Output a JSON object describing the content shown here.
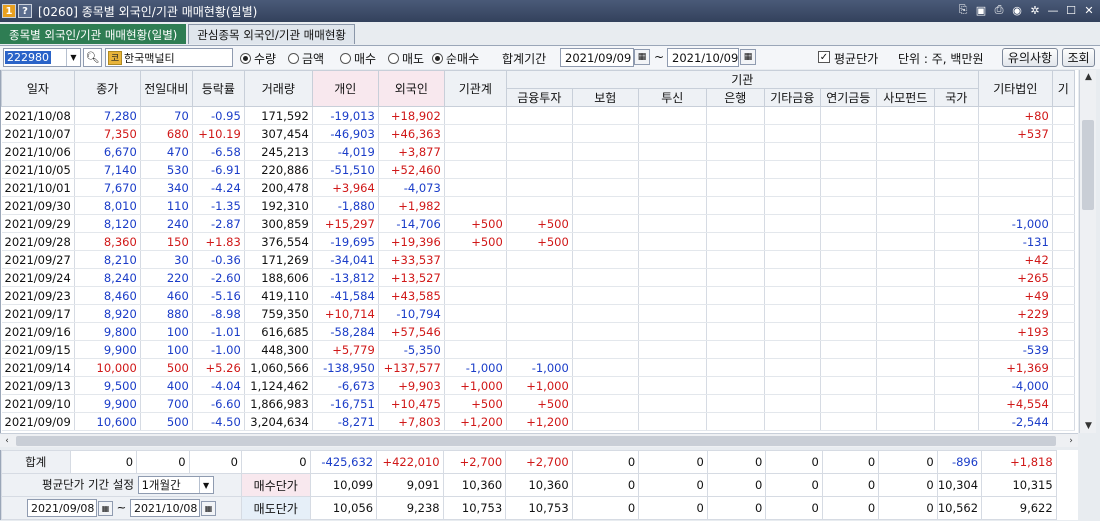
{
  "window": {
    "badge1": "1",
    "badge2": "?",
    "title": "[0260] 종목별 외국인/기관 매매현황(일별)"
  },
  "tabs": [
    "종목별 외국인/기관 매매현황(일별)",
    "관심종목 외국인/기관 매매현황"
  ],
  "toolbar": {
    "code": "222980",
    "name_badge": "코",
    "name": "한국맥널티",
    "radio1": [
      "수량",
      "금액"
    ],
    "radio2": [
      "매수",
      "매도",
      "순매수"
    ],
    "period_label": "합계기간",
    "date_from": "2021/09/09",
    "tilde": "~",
    "date_to": "2021/10/09",
    "avg_label": "평균단가",
    "unit_label": "단위 : 주, 백만원",
    "notice_btn": "유의사항",
    "query_btn": "조회"
  },
  "headers": {
    "date": "일자",
    "close": "종가",
    "change": "전일대비",
    "rate": "등락률",
    "volume": "거래량",
    "individual": "개인",
    "foreign": "외국인",
    "inst_total": "기관계",
    "inst": "기관",
    "finance": "금융투자",
    "insurance": "보험",
    "trust": "투신",
    "bank": "은행",
    "other_fin": "기타금융",
    "pension": "연기금등",
    "private": "사모펀드",
    "nation": "국가",
    "other_corp": "기타법인",
    "more": "기"
  },
  "rows": [
    {
      "date": "2021/10/08",
      "close": "7,280",
      "cc": "dn",
      "change": "70",
      "hc": "dn",
      "rate": "-0.95",
      "rc": "dn",
      "volume": "171,592",
      "ind": "-19,013",
      "ic": "dn",
      "frg": "+18,902",
      "fc": "up",
      "inst": "",
      "fin": "",
      "ocorp": "+80",
      "oc": "up"
    },
    {
      "date": "2021/10/07",
      "close": "7,350",
      "cc": "up",
      "change": "680",
      "hc": "up",
      "rate": "+10.19",
      "rc": "up",
      "volume": "307,454",
      "ind": "-46,903",
      "ic": "dn",
      "frg": "+46,363",
      "fc": "up",
      "inst": "",
      "fin": "",
      "ocorp": "+537",
      "oc": "up"
    },
    {
      "date": "2021/10/06",
      "close": "6,670",
      "cc": "dn",
      "change": "470",
      "hc": "dn",
      "rate": "-6.58",
      "rc": "dn",
      "volume": "245,213",
      "ind": "-4,019",
      "ic": "dn",
      "frg": "+3,877",
      "fc": "up",
      "inst": "",
      "fin": "",
      "ocorp": "",
      "oc": "bk"
    },
    {
      "date": "2021/10/05",
      "close": "7,140",
      "cc": "dn",
      "change": "530",
      "hc": "dn",
      "rate": "-6.91",
      "rc": "dn",
      "volume": "220,886",
      "ind": "-51,510",
      "ic": "dn",
      "frg": "+52,460",
      "fc": "up",
      "inst": "",
      "fin": "",
      "ocorp": "",
      "oc": "bk"
    },
    {
      "date": "2021/10/01",
      "close": "7,670",
      "cc": "dn",
      "change": "340",
      "hc": "dn",
      "rate": "-4.24",
      "rc": "dn",
      "volume": "200,478",
      "ind": "+3,964",
      "ic": "up",
      "frg": "-4,073",
      "fc": "dn",
      "inst": "",
      "fin": "",
      "ocorp": "",
      "oc": "bk"
    },
    {
      "date": "2021/09/30",
      "close": "8,010",
      "cc": "dn",
      "change": "110",
      "hc": "dn",
      "rate": "-1.35",
      "rc": "dn",
      "volume": "192,310",
      "ind": "-1,880",
      "ic": "dn",
      "frg": "+1,982",
      "fc": "up",
      "inst": "",
      "fin": "",
      "ocorp": "",
      "oc": "bk"
    },
    {
      "date": "2021/09/29",
      "close": "8,120",
      "cc": "dn",
      "change": "240",
      "hc": "dn",
      "rate": "-2.87",
      "rc": "dn",
      "volume": "300,859",
      "ind": "+15,297",
      "ic": "up",
      "frg": "-14,706",
      "fc": "dn",
      "inst": "+500",
      "fin": "+500",
      "ocorp": "-1,000",
      "oc": "dn"
    },
    {
      "date": "2021/09/28",
      "close": "8,360",
      "cc": "up",
      "change": "150",
      "hc": "up",
      "rate": "+1.83",
      "rc": "up",
      "volume": "376,554",
      "ind": "-19,695",
      "ic": "dn",
      "frg": "+19,396",
      "fc": "up",
      "inst": "+500",
      "fin": "+500",
      "ocorp": "-131",
      "oc": "dn"
    },
    {
      "date": "2021/09/27",
      "close": "8,210",
      "cc": "dn",
      "change": "30",
      "hc": "dn",
      "rate": "-0.36",
      "rc": "dn",
      "volume": "171,269",
      "ind": "-34,041",
      "ic": "dn",
      "frg": "+33,537",
      "fc": "up",
      "inst": "",
      "fin": "",
      "ocorp": "+42",
      "oc": "up"
    },
    {
      "date": "2021/09/24",
      "close": "8,240",
      "cc": "dn",
      "change": "220",
      "hc": "dn",
      "rate": "-2.60",
      "rc": "dn",
      "volume": "188,606",
      "ind": "-13,812",
      "ic": "dn",
      "frg": "+13,527",
      "fc": "up",
      "inst": "",
      "fin": "",
      "ocorp": "+265",
      "oc": "up"
    },
    {
      "date": "2021/09/23",
      "close": "8,460",
      "cc": "dn",
      "change": "460",
      "hc": "dn",
      "rate": "-5.16",
      "rc": "dn",
      "volume": "419,110",
      "ind": "-41,584",
      "ic": "dn",
      "frg": "+43,585",
      "fc": "up",
      "inst": "",
      "fin": "",
      "ocorp": "+49",
      "oc": "up"
    },
    {
      "date": "2021/09/17",
      "close": "8,920",
      "cc": "dn",
      "change": "880",
      "hc": "dn",
      "rate": "-8.98",
      "rc": "dn",
      "volume": "759,350",
      "ind": "+10,714",
      "ic": "up",
      "frg": "-10,794",
      "fc": "dn",
      "inst": "",
      "fin": "",
      "ocorp": "+229",
      "oc": "up"
    },
    {
      "date": "2021/09/16",
      "close": "9,800",
      "cc": "dn",
      "change": "100",
      "hc": "dn",
      "rate": "-1.01",
      "rc": "dn",
      "volume": "616,685",
      "ind": "-58,284",
      "ic": "dn",
      "frg": "+57,546",
      "fc": "up",
      "inst": "",
      "fin": "",
      "ocorp": "+193",
      "oc": "up"
    },
    {
      "date": "2021/09/15",
      "close": "9,900",
      "cc": "dn",
      "change": "100",
      "hc": "dn",
      "rate": "-1.00",
      "rc": "dn",
      "volume": "448,300",
      "ind": "+5,779",
      "ic": "up",
      "frg": "-5,350",
      "fc": "dn",
      "inst": "",
      "fin": "",
      "ocorp": "-539",
      "oc": "dn"
    },
    {
      "date": "2021/09/14",
      "close": "10,000",
      "cc": "up",
      "change": "500",
      "hc": "up",
      "rate": "+5.26",
      "rc": "up",
      "volume": "1,060,566",
      "ind": "-138,950",
      "ic": "dn",
      "frg": "+137,577",
      "fc": "up",
      "inst": "-1,000",
      "fin": "-1,000",
      "ocorp": "+1,369",
      "oc": "up"
    },
    {
      "date": "2021/09/13",
      "close": "9,500",
      "cc": "dn",
      "change": "400",
      "hc": "dn",
      "rate": "-4.04",
      "rc": "dn",
      "volume": "1,124,462",
      "ind": "-6,673",
      "ic": "dn",
      "frg": "+9,903",
      "fc": "up",
      "inst": "+1,000",
      "fin": "+1,000",
      "ocorp": "-4,000",
      "oc": "dn"
    },
    {
      "date": "2021/09/10",
      "close": "9,900",
      "cc": "dn",
      "change": "700",
      "hc": "dn",
      "rate": "-6.60",
      "rc": "dn",
      "volume": "1,866,983",
      "ind": "-16,751",
      "ic": "dn",
      "frg": "+10,475",
      "fc": "up",
      "inst": "+500",
      "fin": "+500",
      "ocorp": "+4,554",
      "oc": "up"
    },
    {
      "date": "2021/09/09",
      "close": "10,600",
      "cc": "dn",
      "change": "500",
      "hc": "dn",
      "rate": "-4.50",
      "rc": "dn",
      "volume": "3,204,634",
      "ind": "-8,271",
      "ic": "dn",
      "frg": "+7,803",
      "fc": "up",
      "inst": "+1,200",
      "fin": "+1,200",
      "ocorp": "-2,544",
      "oc": "dn"
    }
  ],
  "summary": {
    "label": "합계",
    "cells": [
      "0",
      "0",
      "0",
      "0",
      "-425,632",
      "+422,010",
      "+2,700",
      "+2,700",
      "0",
      "0",
      "0",
      "0",
      "0",
      "0",
      "-896",
      "+1,818"
    ],
    "avg_period_label": "평균단가 기간 설정",
    "avg_period_value": "1개월간",
    "buy_label": "매수단가",
    "buy": [
      "10,099",
      "9,091",
      "10,360",
      "10,360",
      "0",
      "0",
      "0",
      "0",
      "0",
      "0",
      "10,304",
      "10,315"
    ],
    "sell_label": "매도단가",
    "sell": [
      "10,056",
      "9,238",
      "10,753",
      "10,753",
      "0",
      "0",
      "0",
      "0",
      "0",
      "0",
      "10,562",
      "9,622"
    ],
    "from": "2021/09/08",
    "tilde": "~",
    "to": "2021/10/08"
  },
  "colors": {
    "up": "#d01818",
    "down": "#1a3cc8",
    "accent_tab": "#2e7d53"
  }
}
